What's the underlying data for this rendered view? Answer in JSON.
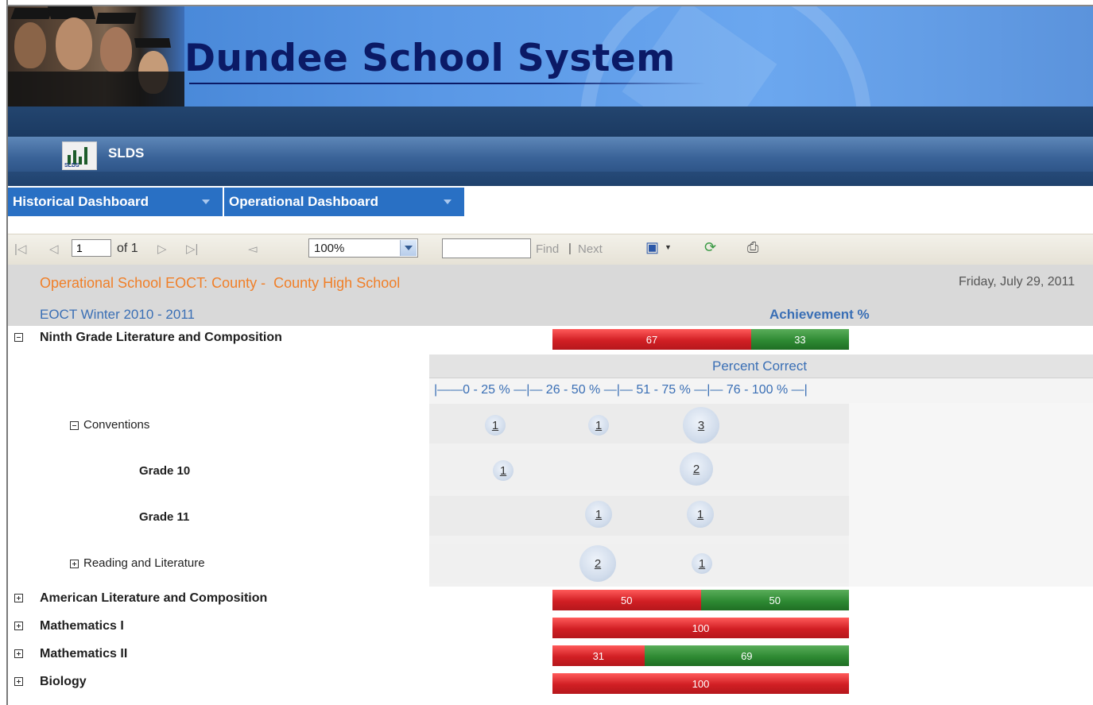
{
  "banner": {
    "title": "Dundee School System"
  },
  "app": {
    "name": "SLDS",
    "logo_text": "SLDS"
  },
  "nav": [
    {
      "label": "Historical Dashboard"
    },
    {
      "label": "Operational Dashboard"
    }
  ],
  "toolbar": {
    "page_value": "1",
    "page_of": "of 1",
    "zoom": "100%",
    "search_value": "",
    "find_label": "Find",
    "separator": "|",
    "next_label": "Next",
    "icons": [
      "first-page-icon",
      "prev-page-icon",
      "next-page-icon",
      "last-page-icon",
      "back-icon",
      "save-icon",
      "refresh-icon",
      "print-icon"
    ]
  },
  "report": {
    "title_part1": "Operational School EOCT: County -",
    "title_part2": "County High School",
    "date": "Friday, July 29, 2011",
    "subtitle": "EOCT  Winter  2010 - 2011",
    "achievement_header": "Achievement %",
    "percent_correct_header": "Percent Correct",
    "scale": "|——0 - 25 % —|— 26 - 50 % —|— 51 - 75 % —|— 76 - 100 % —|"
  },
  "subjects": [
    {
      "name": "Ninth Grade Literature and Composition",
      "expanded": true,
      "segments": [
        {
          "value": 67,
          "color": "red"
        },
        {
          "value": 33,
          "color": "green"
        }
      ]
    },
    {
      "name": "American Literature and Composition",
      "expanded": false,
      "segments": [
        {
          "value": 50,
          "color": "red"
        },
        {
          "value": 50,
          "color": "green"
        }
      ]
    },
    {
      "name": "Mathematics I",
      "expanded": false,
      "segments": [
        {
          "value": 100,
          "color": "red"
        }
      ]
    },
    {
      "name": "Mathematics II",
      "expanded": false,
      "segments": [
        {
          "value": 31,
          "color": "red"
        },
        {
          "value": 69,
          "color": "green"
        }
      ]
    },
    {
      "name": "Biology",
      "expanded": false,
      "segments": [
        {
          "value": 100,
          "color": "red"
        }
      ]
    }
  ],
  "details": [
    {
      "label": "Conventions",
      "expander": "minus",
      "counts": [
        "1",
        "1",
        "3",
        ""
      ]
    },
    {
      "label": "Grade 10",
      "expander": "",
      "counts": [
        "1",
        "",
        "2",
        ""
      ]
    },
    {
      "label": "Grade 11",
      "expander": "",
      "counts": [
        "",
        "1",
        "1",
        ""
      ]
    },
    {
      "label": "Reading and Literature",
      "expander": "plus",
      "counts": [
        "",
        "2",
        "1",
        ""
      ]
    }
  ]
}
